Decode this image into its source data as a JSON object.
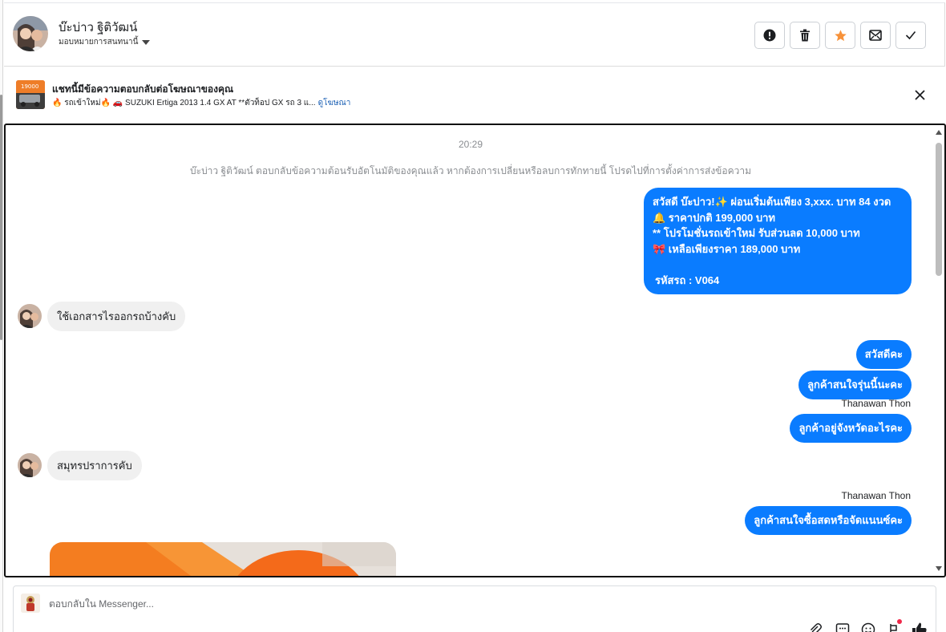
{
  "header": {
    "contact_name": "บ๊ะบ่าว ฐิติวัฒน์",
    "assign_label": "มอบหมายการสนทนานี้",
    "actions": [
      {
        "name": "spam-button",
        "icon": "exclamation-icon"
      },
      {
        "name": "delete-button",
        "icon": "trash-icon"
      },
      {
        "name": "star-button",
        "icon": "star-icon"
      },
      {
        "name": "mark-unread-button",
        "icon": "envelope-icon"
      },
      {
        "name": "mark-done-button",
        "icon": "check-icon"
      }
    ],
    "star_color": "#f7923a"
  },
  "ad_banner": {
    "title": "แชทนี้มีข้อความตอบกลับต่อโฆษณาของคุณ",
    "description": "🔥 รถเข้าใหม่🔥 🚗 SUZUKI Ertiga 2013 1.4 GX AT **ตัวท็อป GX รถ 3 แ...",
    "view_ad_link": "ดูโฆษณา",
    "thumb_text": "19000"
  },
  "chat": {
    "timestamp": "20:29",
    "system_note": "บ๊ะบ่าว ฐิติวัฒน์ ตอบกลับข้อความต้อนรับอัตโนมัติของคุณแล้ว หากต้องการเปลี่ยนหรือลบการทักทายนี้ โปรดไปที่การตั้งค่าการส่งข้อความ",
    "welcome_lines": [
      "สวัสดี บ๊ะบ่าว!✨  ผ่อนเริ่มต้นเพียง 3,xxx. บาท 84 งวด",
      "🔔 ราคาปกติ 199,000 บาท",
      "** โปรโมชั่นรถเข้าใหม่ รับส่วนลด 10,000 บาท",
      "🎀  เหลือเพียงราคา 189,000 บาท",
      "",
      "รหัสรถ : V064"
    ],
    "incoming_1": "ใช้เอกสารไรออกรถบ้างคับ",
    "outgoing_1": "สวัสดีคะ",
    "outgoing_2": "ลูกค้าสนใจรุ่นนี้นะคะ",
    "sender_1": "Thanawan Thon",
    "outgoing_3": "ลูกค้าอยู่จังหวัดอะไรคะ",
    "incoming_2": "สมุทรปราการคับ",
    "sender_2": "Thanawan Thon",
    "outgoing_4": "ลูกค้าสนใจซื้อสดหรือจัดแนนซ์คะ",
    "bubble_color": "#0a7cff"
  },
  "composer": {
    "placeholder": "ตอบกลับใน Messenger...",
    "tools": [
      "paperclip-icon",
      "saved-reply-icon",
      "emoji-icon",
      "bookmark-icon",
      "thumbs-up-icon"
    ]
  }
}
